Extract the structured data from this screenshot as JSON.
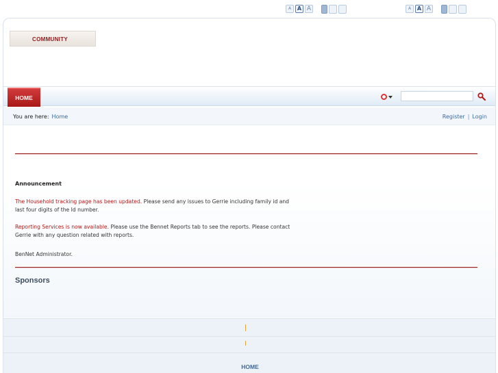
{
  "font_controls": {
    "size_small": "A",
    "size_medium": "A",
    "size_large": "A"
  },
  "logo": {
    "text": "COMMUNITY"
  },
  "nav": {
    "home_tab": "HOME",
    "search_placeholder": "",
    "search_value": ""
  },
  "breadcrumb": {
    "prefix": "You are here:",
    "current": "Home"
  },
  "user_links": {
    "register": "Register",
    "separator": "|",
    "login": "Login"
  },
  "announcement": {
    "title": "Announcement",
    "item1_highlight": "The Household tracking page has been updated.",
    "item1_text": " Please send any issues to Gerrie including family id and last four digits of the Id number.",
    "item2_highlight": "Reporting Services is now available.",
    "item2_text": " Please use the Bennet Reports tab to see the reports. Please contact Gerrie with any question related with reports.",
    "signature": "BenNet Administrator."
  },
  "sponsors": {
    "title": "Sponsors"
  },
  "footer": {
    "home_link": "HOME"
  },
  "colors": {
    "accent_red": "#a81818",
    "link_blue": "#3b6aa0",
    "highlight_red": "#b81414"
  },
  "icons": {
    "search": "magnifier-icon",
    "scope": "search-scope-icon"
  }
}
